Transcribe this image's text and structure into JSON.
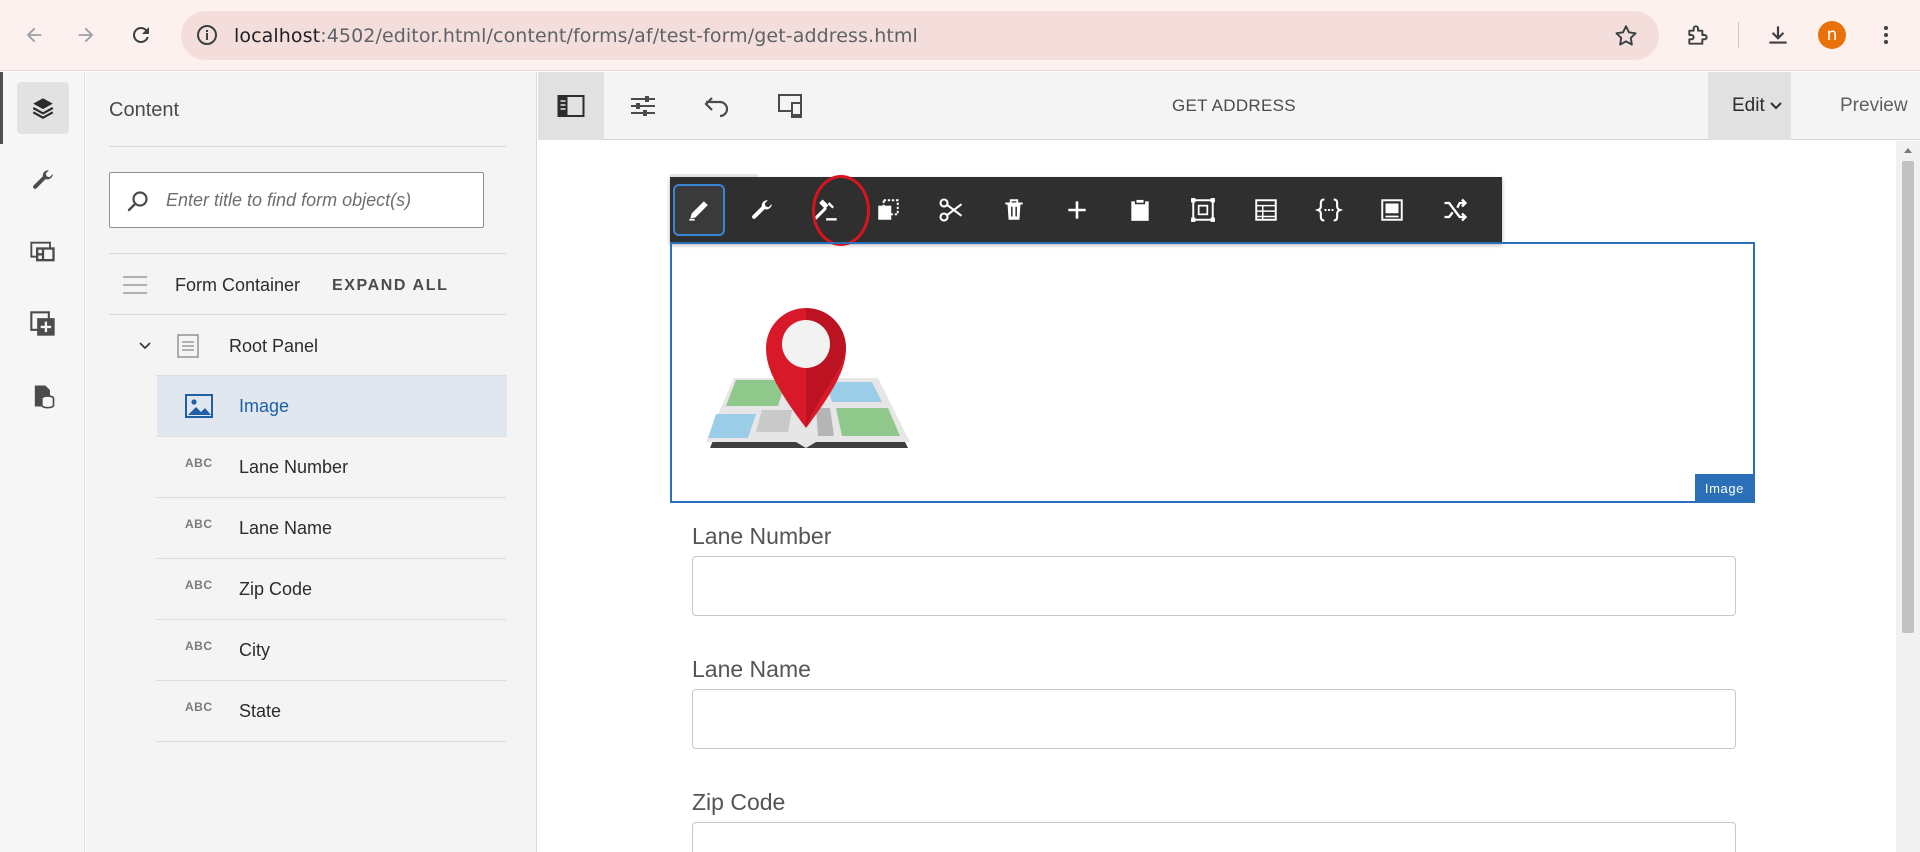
{
  "browser": {
    "url_host": "localhost",
    "url_path": ":4502/editor.html/content/forms/af/test-form/get-address.html",
    "avatar_initial": "n",
    "accent": "#e8710a"
  },
  "sidebar": {
    "panel_title": "Content",
    "search_placeholder": "Enter title to find form object(s)",
    "tree": {
      "container_label": "Form Container",
      "expand_all_label": "EXPAND ALL",
      "root_label": "Root Panel",
      "items": [
        {
          "label": "Image",
          "type": "image",
          "selected": true
        },
        {
          "label": "Lane Number",
          "type": "ABC",
          "selected": false
        },
        {
          "label": "Lane Name",
          "type": "ABC",
          "selected": false
        },
        {
          "label": "Zip Code",
          "type": "ABC",
          "selected": false
        },
        {
          "label": "City",
          "type": "ABC",
          "selected": false
        },
        {
          "label": "State",
          "type": "ABC",
          "selected": false
        }
      ],
      "abc_text": "ABC"
    }
  },
  "editor": {
    "page_title": "GET ADDRESS",
    "mode": "Edit",
    "preview_label": "Preview"
  },
  "component": {
    "badge": "Image",
    "toolbar_icons": [
      "pencil-icon",
      "wrench-icon",
      "rule-gavel-icon",
      "copy-icon",
      "scissors-icon",
      "trash-icon",
      "plus-icon",
      "clipboard-icon",
      "group-icon",
      "table-icon",
      "curly-braces-icon",
      "embed-icon",
      "shuffle-icon"
    ]
  },
  "form": {
    "fields": [
      {
        "label": "Lane Number",
        "value": ""
      },
      {
        "label": "Lane Name",
        "value": ""
      },
      {
        "label": "Zip Code",
        "value": ""
      }
    ]
  }
}
